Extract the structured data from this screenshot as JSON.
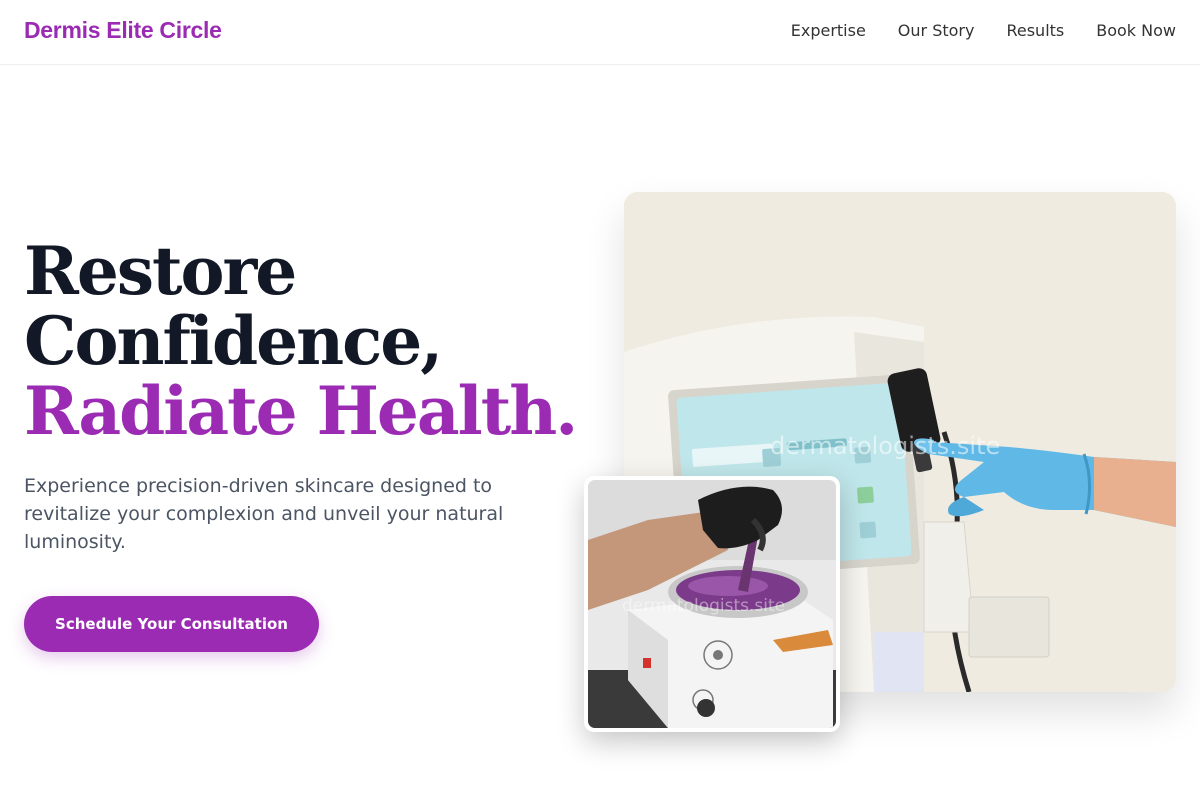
{
  "header": {
    "brand": "Dermis Elite Circle",
    "nav": [
      {
        "label": "Expertise"
      },
      {
        "label": "Our Story"
      },
      {
        "label": "Results"
      },
      {
        "label": "Book Now"
      }
    ]
  },
  "hero": {
    "headline_line1": "Restore",
    "headline_line2": "Confidence,",
    "headline_accent": "Radiate Health.",
    "subtext": "Experience precision-driven skincare designed to revitalize your complexion and unveil your natural luminosity.",
    "cta_label": "Schedule Your Consultation"
  },
  "images": {
    "main_watermark": "dermatologists.site",
    "inset_watermark": "dermatologists.site",
    "main_alt": "gloved hand touching skincare device screen",
    "inset_alt": "hand stirring purple wax in wax heater"
  },
  "colors": {
    "accent": "#9b2bb3",
    "headline": "#121826",
    "body_text": "#4b5563"
  }
}
